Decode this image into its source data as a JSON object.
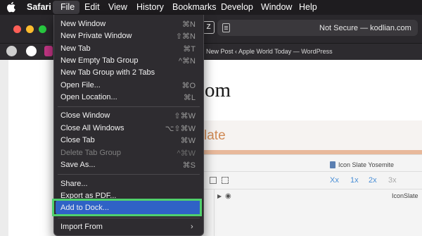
{
  "menubar": {
    "app_name": "Safari",
    "items": [
      "File",
      "Edit",
      "View",
      "History",
      "Bookmarks",
      "Develop",
      "Window",
      "Help"
    ]
  },
  "safari": {
    "address": "Not Secure — kodlian.com",
    "tab_title": "New Post ‹ Apple World Today — WordPress",
    "zoom_letter": "Z"
  },
  "page": {
    "heading": "om",
    "band_text": "late",
    "panel_label": "Icon Slate Yosemite",
    "tools": [
      "Xx",
      "1x",
      "2x",
      "3x"
    ],
    "row_label": "IconSlate"
  },
  "file_menu": {
    "items": [
      {
        "label": "New Window",
        "shortcut": "⌘N",
        "disabled": false
      },
      {
        "label": "New Private Window",
        "shortcut": "⇧⌘N",
        "disabled": false
      },
      {
        "label": "New Tab",
        "shortcut": "⌘T",
        "disabled": false
      },
      {
        "label": "New Empty Tab Group",
        "shortcut": "^⌘N",
        "disabled": false
      },
      {
        "label": "New Tab Group with 2 Tabs",
        "shortcut": "",
        "disabled": false
      },
      {
        "label": "Open File...",
        "shortcut": "⌘O",
        "disabled": false
      },
      {
        "label": "Open Location...",
        "shortcut": "⌘L",
        "disabled": false
      },
      {
        "label": "Close Window",
        "shortcut": "⇧⌘W",
        "disabled": false
      },
      {
        "label": "Close All Windows",
        "shortcut": "⌥⇧⌘W",
        "disabled": false
      },
      {
        "label": "Close Tab",
        "shortcut": "⌘W",
        "disabled": false
      },
      {
        "label": "Delete Tab Group",
        "shortcut": "^⌘W",
        "disabled": true
      },
      {
        "label": "Save As...",
        "shortcut": "⌘S",
        "disabled": false
      },
      {
        "label": "Share...",
        "shortcut": "",
        "disabled": false
      },
      {
        "label": "Export as PDF...",
        "shortcut": "",
        "disabled": false
      },
      {
        "label": "Add to Dock...",
        "shortcut": "",
        "disabled": false,
        "highlighted": true
      },
      {
        "label": "Import From",
        "shortcut": "",
        "disabled": false,
        "submenu": true
      }
    ]
  },
  "colors": {
    "menubar_bg": "#1e1c1f",
    "menu_bg": "#2e2c30",
    "highlight": "#2f62c6",
    "annotation_box": "#4fd06d",
    "traffic_red": "#fe5f57",
    "traffic_yellow": "#febc2e",
    "traffic_green": "#28c840"
  },
  "icons": {
    "apple": "apple-logo-icon",
    "submenu": "chevron-right-icon",
    "reader": "reader-icon",
    "eye": "eye-icon"
  }
}
